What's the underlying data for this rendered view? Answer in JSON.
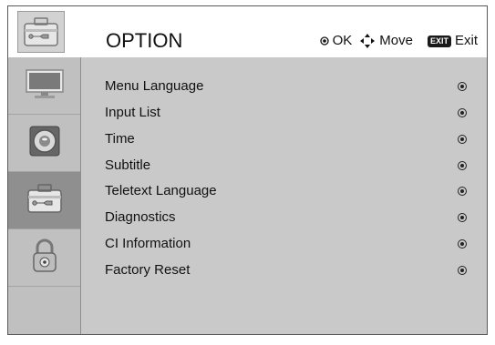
{
  "header": {
    "title": "OPTION",
    "hints": [
      {
        "icon": "ok-circle-icon",
        "label": "OK"
      },
      {
        "icon": "move-arrows-icon",
        "label": "Move"
      },
      {
        "icon": "exit-button-icon",
        "badge": "EXIT",
        "label": "Exit"
      }
    ]
  },
  "sidebar": {
    "items": [
      {
        "icon": "tv-monitor-icon",
        "selected": false
      },
      {
        "icon": "speaker-icon",
        "selected": false
      },
      {
        "icon": "toolbox-icon",
        "selected": true
      },
      {
        "icon": "padlock-icon",
        "selected": false
      }
    ]
  },
  "menu": {
    "items": [
      {
        "label": "Menu Language"
      },
      {
        "label": "Input List"
      },
      {
        "label": "Time"
      },
      {
        "label": "Subtitle"
      },
      {
        "label": "Teletext Language"
      },
      {
        "label": "Diagnostics"
      },
      {
        "label": "CI Information"
      },
      {
        "label": "Factory Reset"
      }
    ]
  },
  "colors": {
    "panel": "#c9c9c9",
    "sidebar": "#c0c0c0",
    "selected": "#8f8f8f",
    "text": "#111111"
  }
}
